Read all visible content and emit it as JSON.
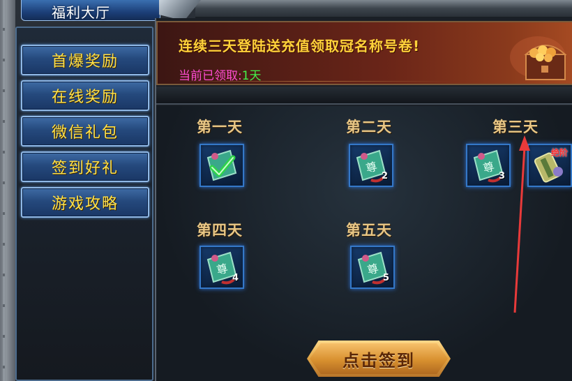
{
  "window": {
    "title": "福利大厅"
  },
  "sidebar": {
    "items": [
      {
        "label": "首爆奖励"
      },
      {
        "label": "在线奖励"
      },
      {
        "label": "微信礼包"
      },
      {
        "label": "签到好礼"
      },
      {
        "label": "游戏攻略"
      }
    ]
  },
  "banner": {
    "title": "连续三天登陆送充值领取冠名称号卷!",
    "received_label": "当前已领取:",
    "received_value": "1天"
  },
  "days": [
    {
      "label": "第一天",
      "items": [
        {
          "icon": "title-card-icon",
          "claimed": true
        }
      ]
    },
    {
      "label": "第二天",
      "items": [
        {
          "icon": "title-card-icon",
          "count": "2"
        }
      ]
    },
    {
      "label": "第三天",
      "items": [
        {
          "icon": "title-card-icon",
          "count": "3"
        },
        {
          "icon": "scroll-icon",
          "badge": "绝阶"
        }
      ]
    },
    {
      "label": "第四天",
      "items": [
        {
          "icon": "title-card-icon",
          "count": "4"
        }
      ]
    },
    {
      "label": "第五天",
      "items": [
        {
          "icon": "title-card-icon",
          "count": "5"
        }
      ]
    }
  ],
  "sign_button": {
    "label": "点击签到"
  },
  "colors": {
    "menu_text": "#ffe14a",
    "banner_title": "#ffd23a",
    "received_label": "#ff4cd2",
    "received_value": "#44f24a",
    "day_label": "#e9c785",
    "annotation_arrow": "#e83a3a"
  }
}
